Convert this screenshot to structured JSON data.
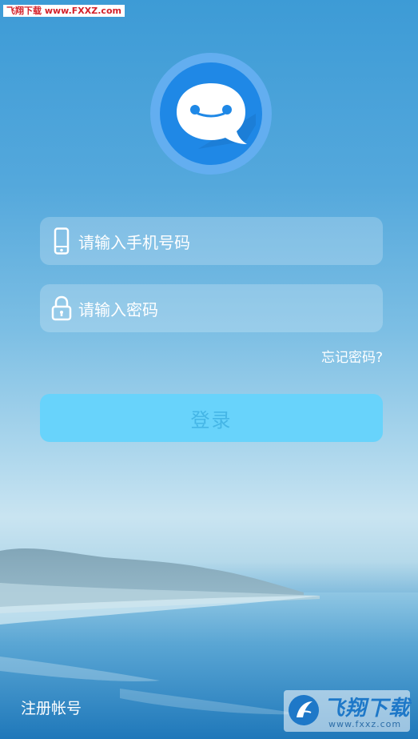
{
  "watermark": {
    "top_text": "飞翔下载 www.FXXZ.com",
    "bottom_title": "飞翔下载",
    "bottom_url": "www.fxxz.com"
  },
  "app": {
    "logo_icon": "chat-bubble-face-icon"
  },
  "login": {
    "phone_placeholder": "请输入手机号码",
    "password_placeholder": "请输入密码",
    "phone_icon": "phone-icon",
    "lock_icon": "lock-icon",
    "forgot_label": "忘记密码?",
    "login_label": "登录",
    "register_label": "注册帐号"
  },
  "colors": {
    "login_button": "#68d3fb",
    "login_text": "#45b6e6",
    "logo_ring": "#63aef0",
    "logo_inner": "#1f88e6"
  }
}
